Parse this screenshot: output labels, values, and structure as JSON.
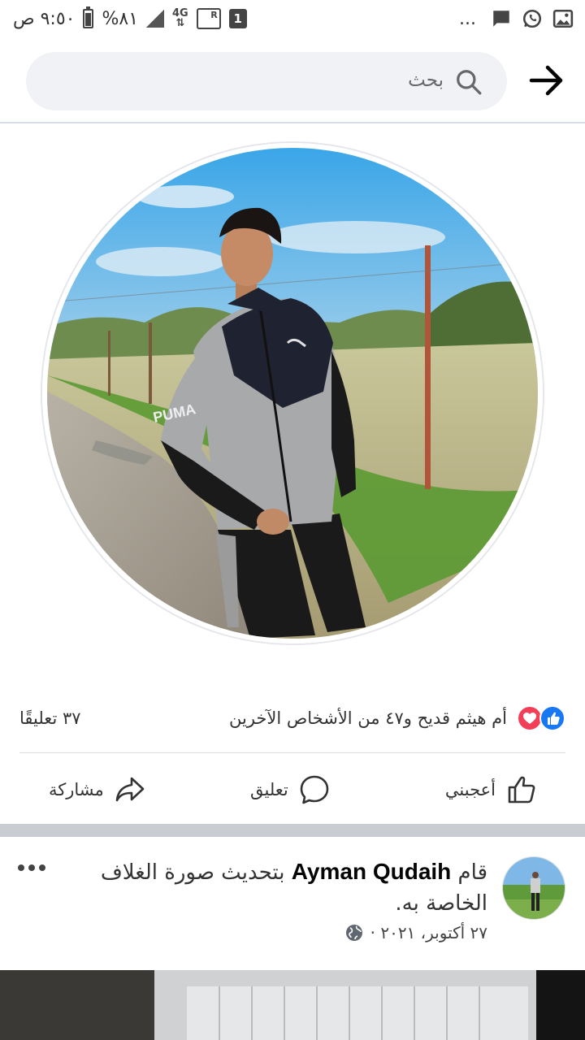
{
  "status_bar": {
    "time": "٩:٥٠ ص",
    "battery": "%٨١",
    "network": "4G",
    "sim": "1",
    "more": "...",
    "icons": [
      "gallery-icon",
      "whatsapp-icon",
      "message-icon"
    ]
  },
  "header": {
    "search_label": "بحث",
    "back_icon": "arrow-right-icon"
  },
  "reactions": {
    "summary": "أم هيثم قديح و٤٧ من الأشخاص الآخرين",
    "comments": "٣٧ تعليقًا",
    "types": [
      "like",
      "love"
    ]
  },
  "actions": {
    "like": "أعجبني",
    "comment": "تعليق",
    "share": "مشاركة"
  },
  "post": {
    "verb": "قام",
    "author": "Ayman Qudaih",
    "action_text": "بتحديث صورة الغلاف الخاصة به.",
    "date": "٢٧ أكتوبر، ٢٠٢١ ·",
    "privacy_icon": "globe-icon"
  },
  "colors": {
    "facebook_blue": "#1877f2",
    "love_red": "#f33e58",
    "search_bg": "#f0f2f5"
  }
}
